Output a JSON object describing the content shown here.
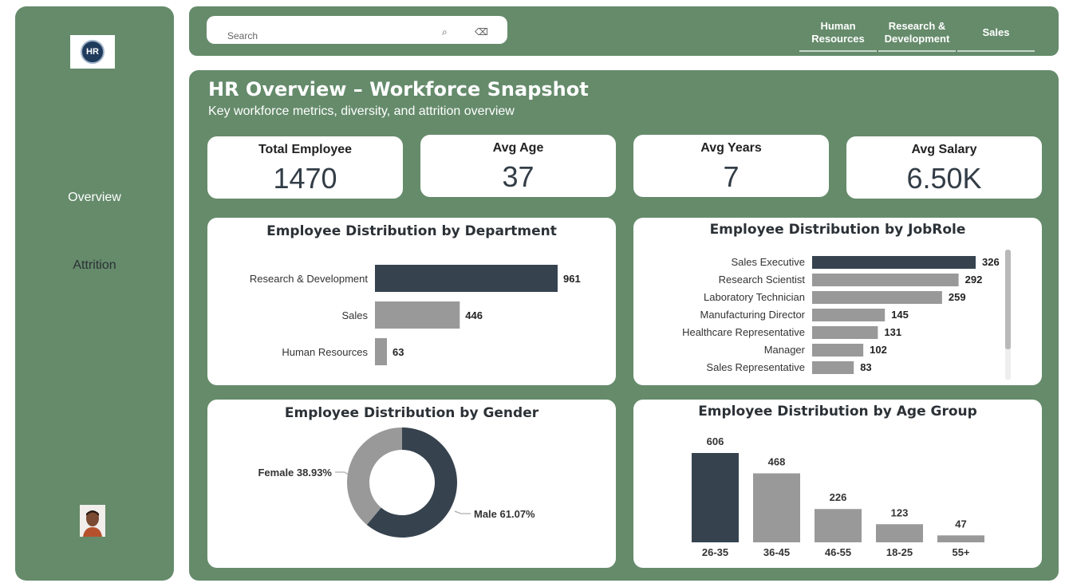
{
  "sidebar": {
    "logo_text": "HR",
    "nav": [
      {
        "label": "Overview"
      },
      {
        "label": "Attrition"
      }
    ]
  },
  "topbar": {
    "search_placeholder": "Search",
    "departments": [
      {
        "label": "Human Resources"
      },
      {
        "label": "Research & Development"
      },
      {
        "label": "Sales"
      }
    ]
  },
  "main": {
    "title": "HR Overview – Workforce Snapshot",
    "subtitle": "Key workforce metrics, diversity, and attrition overview",
    "kpis": [
      {
        "label": "Total Employee",
        "value": "1470"
      },
      {
        "label": "Avg Age",
        "value": "37"
      },
      {
        "label": "Avg Years",
        "value": "7"
      },
      {
        "label": "Avg Salary",
        "value": "6.50K"
      }
    ]
  },
  "colors": {
    "accent": "#658b6b",
    "dark_bar": "#36434f",
    "gray_bar": "#999999"
  },
  "chart_data": [
    {
      "type": "bar",
      "orientation": "horizontal",
      "title": "Employee Distribution by Department",
      "categories": [
        "Research & Development",
        "Sales",
        "Human Resources"
      ],
      "values": [
        961,
        446,
        63
      ]
    },
    {
      "type": "bar",
      "orientation": "horizontal",
      "title": "Employee Distribution by JobRole",
      "categories": [
        "Sales Executive",
        "Research Scientist",
        "Laboratory Technician",
        "Manufacturing Director",
        "Healthcare Representative",
        "Manager",
        "Sales Representative"
      ],
      "values": [
        326,
        292,
        259,
        145,
        131,
        102,
        83
      ]
    },
    {
      "type": "pie",
      "title": "Employee Distribution by Gender",
      "categories": [
        "Female",
        "Male"
      ],
      "values": [
        38.93,
        61.07
      ],
      "labels": [
        "Female 38.93%",
        "Male 61.07%"
      ]
    },
    {
      "type": "bar",
      "title": "Employee Distribution by Age Group",
      "categories": [
        "26-35",
        "36-45",
        "46-55",
        "18-25",
        "55+"
      ],
      "values": [
        606,
        468,
        226,
        123,
        47
      ]
    }
  ]
}
